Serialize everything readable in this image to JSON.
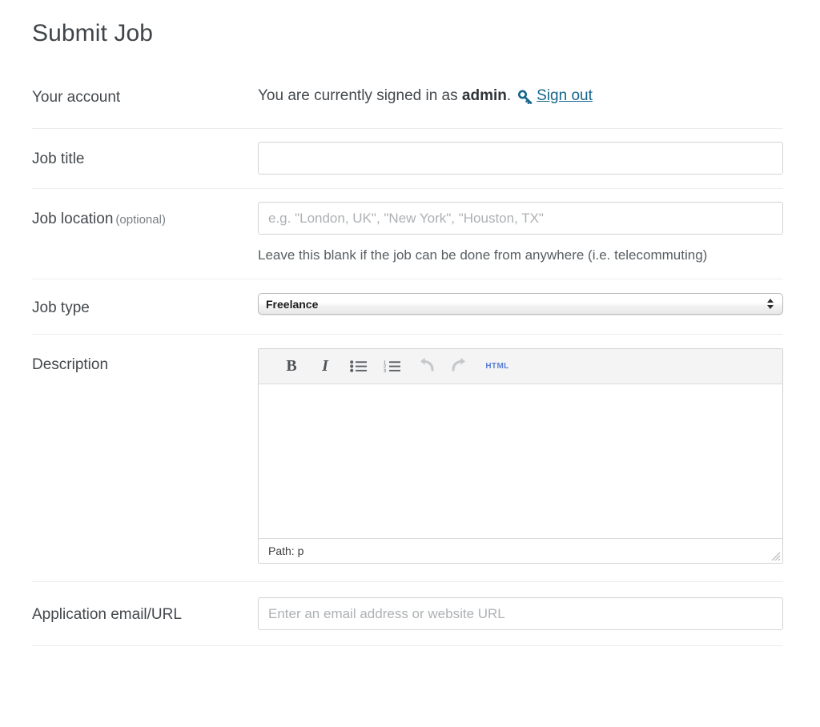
{
  "page": {
    "title": "Submit Job"
  },
  "fields": {
    "account": {
      "label": "Your account",
      "text_before": "You are currently signed in as",
      "username": "admin",
      "text_after": ".",
      "icon": "key-icon",
      "signout_label": "Sign out",
      "link_color": "#15658c"
    },
    "job_title": {
      "label": "Job title",
      "value": "",
      "placeholder": ""
    },
    "job_location": {
      "label": "Job location",
      "optional_suffix": "(optional)",
      "value": "",
      "placeholder": "e.g. \"London, UK\", \"New York\", \"Houston, TX\"",
      "hint": "Leave this blank if the job can be done from anywhere (i.e. telecommuting)"
    },
    "job_type": {
      "label": "Job type",
      "selected": "Freelance",
      "options": [
        "Freelance"
      ]
    },
    "description": {
      "label": "Description",
      "value": "",
      "toolbar": [
        {
          "name": "bold-button",
          "glyph": "B"
        },
        {
          "name": "italic-button",
          "glyph": "I"
        },
        {
          "name": "bullet-list-button",
          "glyph": "bullet-list-icon"
        },
        {
          "name": "numbered-list-button",
          "glyph": "numbered-list-icon"
        },
        {
          "name": "undo-button",
          "glyph": "undo-icon"
        },
        {
          "name": "redo-button",
          "glyph": "redo-icon"
        },
        {
          "name": "html-button",
          "glyph": "HTML"
        }
      ],
      "status_label": "Path:",
      "status_value": "p",
      "html_button_color": "#5a7fd4"
    },
    "application": {
      "label": "Application email/URL",
      "value": "",
      "placeholder": "Enter an email address or website URL"
    }
  }
}
